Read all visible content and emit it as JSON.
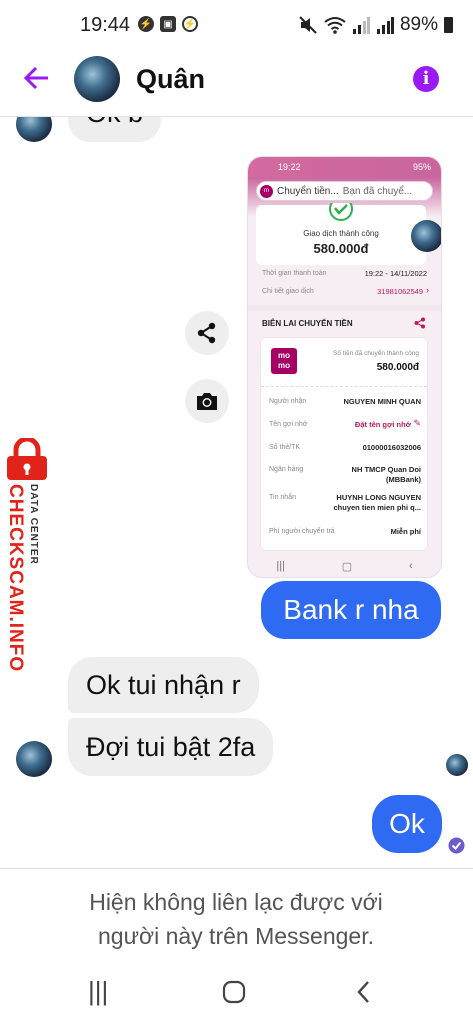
{
  "status_bar": {
    "time": "19:44",
    "battery": "89%",
    "left_icons": [
      "messenger-icon",
      "image-icon",
      "messenger-icon"
    ],
    "right_icons": [
      "mute-icon",
      "wifi-icon",
      "signal-icon",
      "signal-icon",
      "battery-icon"
    ]
  },
  "header": {
    "contact_name": "Quân",
    "accent_color": "#9b19f5"
  },
  "messages": {
    "partial_top": "Ok b",
    "bank_msg": "Bank r nha",
    "reply1": "Ok tui nhận r",
    "reply2": "Đợi tui bật 2fa",
    "ok_msg": "Ok",
    "outgoing_color": "#2f6bf2"
  },
  "receipt": {
    "status_time": "19:22",
    "status_battery": "95%",
    "topbar_title": "Chuyển tiền...",
    "topbar_sub": "Bạn đã chuyể...",
    "success_label": "Giao dịch thành công",
    "amount": "580.000đ",
    "time_label": "Thời gian thanh toán",
    "time_value": "19:22 - 14/11/2022",
    "detail_label": "Chi tiết giao dịch",
    "detail_value": "31981062549",
    "receipt_title": "BIÊN LAI CHUYỂN TIỀN",
    "momo_logo": "mo mo",
    "sent_label": "Số tiền đã chuyển thành công",
    "sent_amount": "580.000đ",
    "receiver_label": "Người nhận",
    "receiver_value": "NGUYEN MINH QUAN",
    "nickname_label": "Tên gợi nhớ",
    "nickname_value": "Đặt tên gợi nhớ",
    "account_label": "Số thẻ/TK",
    "account_value": "01000016032006",
    "bank_label": "Ngân hàng",
    "bank_value": "NH TMCP Quan Doi (MBBank)",
    "message_label": "Tin nhắn",
    "message_value": "HUYNH LONG NGUYEN chuyen tien mien phi q...",
    "fee_label": "Phí người chuyển trả",
    "fee_value": "Miễn phí"
  },
  "watermark": {
    "main": "CHECKSCAM.INFO",
    "sub": "DATA CENTER",
    "color": "#e2231a"
  },
  "footer": {
    "notice": "Hiện không liên lạc được với người này trên Messenger."
  },
  "navbar": {
    "recents": "|||",
    "home": "○",
    "back": "‹"
  }
}
